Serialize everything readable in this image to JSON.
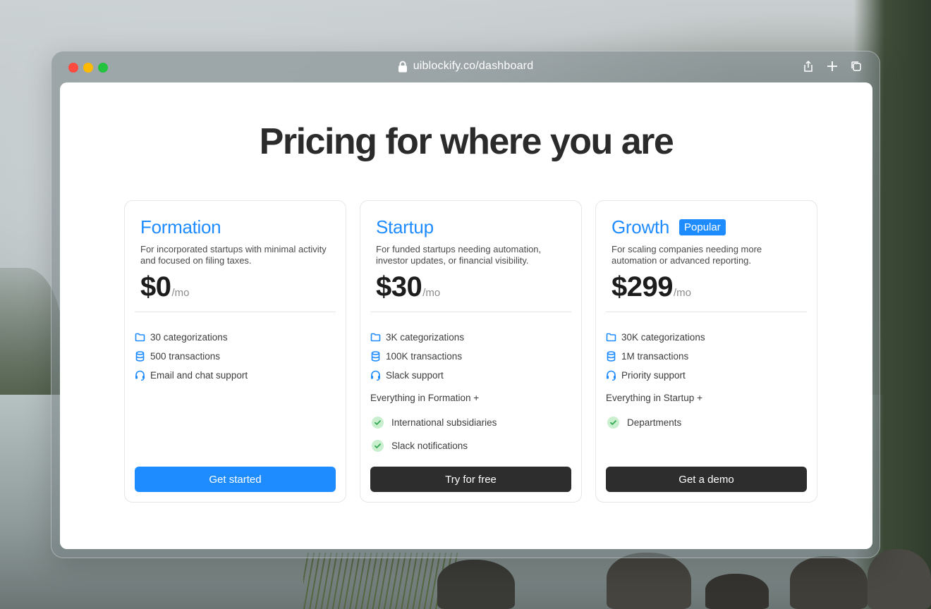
{
  "browser": {
    "url": "uiblockify.co/dashboard"
  },
  "page": {
    "heading": "Pricing for where you are"
  },
  "plans": [
    {
      "name": "Formation",
      "badge": "",
      "description": "For incorporated startups with minimal activity and focused on filing taxes.",
      "price": "$0",
      "unit": "/mo",
      "features": [
        {
          "icon": "folder-icon",
          "label": "30 categorizations"
        },
        {
          "icon": "database-icon",
          "label": "500 transactions"
        },
        {
          "icon": "headset-icon",
          "label": "Email and chat support"
        }
      ],
      "extras_title": "",
      "extras": [],
      "cta": "Get started",
      "cta_style": "blue"
    },
    {
      "name": "Startup",
      "badge": "",
      "description": "For funded startups needing automation, investor updates, or financial visibility.",
      "price": "$30",
      "unit": "/mo",
      "features": [
        {
          "icon": "folder-icon",
          "label": "3K categorizations"
        },
        {
          "icon": "database-icon",
          "label": "100K transactions"
        },
        {
          "icon": "headset-icon",
          "label": "Slack support"
        }
      ],
      "extras_title": "Everything in Formation +",
      "extras": [
        "International subsidiaries",
        "Slack notifications"
      ],
      "cta": "Try for free",
      "cta_style": "dark"
    },
    {
      "name": "Growth",
      "badge": "Popular",
      "description": "For scaling companies needing more automation or advanced reporting.",
      "price": "$299",
      "unit": "/mo",
      "features": [
        {
          "icon": "folder-icon",
          "label": "30K categorizations"
        },
        {
          "icon": "database-icon",
          "label": "1M transactions"
        },
        {
          "icon": "headset-icon",
          "label": "Priority support"
        }
      ],
      "extras_title": "Everything in Startup +",
      "extras": [
        "Departments"
      ],
      "cta": "Get a demo",
      "cta_style": "dark"
    }
  ],
  "colors": {
    "accent": "#1e8cff",
    "dark_button": "#2d2d2d",
    "check_bg": "#c9efcf",
    "check_mark": "#34a853"
  }
}
